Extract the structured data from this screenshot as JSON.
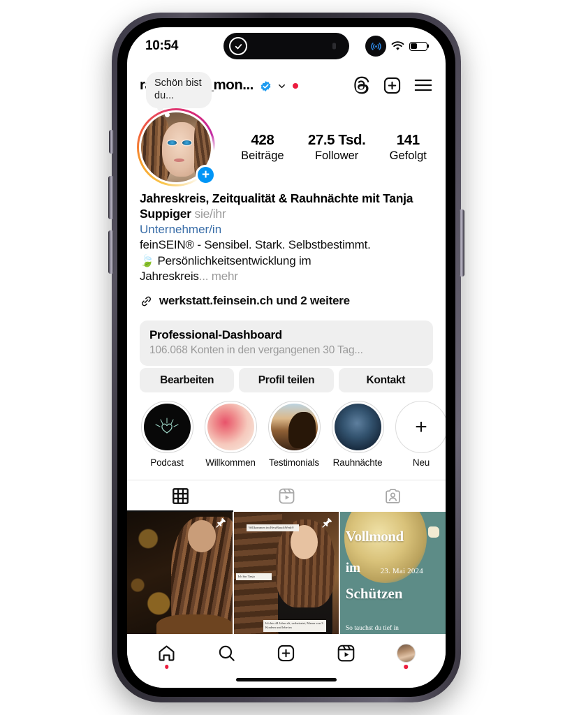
{
  "status_bar": {
    "time": "10:54",
    "dynamic_island_icon": "check-circle-icon",
    "airdrop_icon": "broadcast-icon",
    "wifi_icon": "wifi-icon",
    "battery_icon": "battery-icon",
    "battery_level_percent": 42
  },
  "header": {
    "username": "rauhnacht_mon...",
    "verified_icon": "verified-badge-icon",
    "chevron_icon": "chevron-down-icon",
    "notification_dot": "red-dot-indicator",
    "threads_icon": "threads-icon",
    "new_post_icon": "plus-box-icon",
    "menu_icon": "hamburger-menu-icon"
  },
  "profile": {
    "note_bubble": "Schön bist du...",
    "avatar_name": "profile-avatar",
    "add_story_icon": "plus-circle-icon",
    "stats": [
      {
        "value": "428",
        "label": "Beiträge"
      },
      {
        "value": "27.5 Tsd.",
        "label": "Follower"
      },
      {
        "value": "141",
        "label": "Gefolgt"
      }
    ],
    "display_name": "Jahreskreis, Zeitqualität & Rauhnächte mit Tanja Suppiger",
    "pronouns": "sie/ihr",
    "category": "Unternehmer/in",
    "bio_line_1": "feinSEIN® - Sensibel. Stark. Selbstbestimmt.",
    "bio_line_2": "🍃 Persönlichkeitsentwicklung im",
    "bio_line_3": "Jahreskreis",
    "bio_more": "... mehr",
    "link_icon": "link-chain-icon",
    "link_text": "werkstatt.feinsein.ch und 2 weitere"
  },
  "dashboard": {
    "title": "Professional-Dashboard",
    "subtitle": "106.068 Konten in den vergangenen 30 Tag..."
  },
  "actions": [
    {
      "label": "Bearbeiten"
    },
    {
      "label": "Profil teilen"
    },
    {
      "label": "Kontakt"
    }
  ],
  "highlights": [
    {
      "label": "Podcast",
      "cover": "cover-podcast"
    },
    {
      "label": "Willkommen",
      "cover": "cover-willkommen"
    },
    {
      "label": "Testimonials",
      "cover": "cover-testimonials"
    },
    {
      "label": "Rauhnächte",
      "cover": "cover-rauhnaechte"
    },
    {
      "label": "Neu",
      "cover": "add-new-highlight"
    }
  ],
  "tabs": [
    {
      "name": "grid-tab",
      "icon": "grid-icon",
      "active": true
    },
    {
      "name": "reels-tab",
      "icon": "reels-icon",
      "active": false
    },
    {
      "name": "tagged-tab",
      "icon": "tagged-person-icon",
      "active": false
    }
  ],
  "posts": [
    {
      "name": "post-writing",
      "pinned": true,
      "pin_icon": "pin-icon"
    },
    {
      "name": "post-willkommen",
      "pinned": true,
      "pin_icon": "pin-icon",
      "caption_1": "Willkommen im HerzBauchWerk®",
      "caption_2": "Ich bin Tanja",
      "caption_3": "Ich bin 44 Jahre alt, verheiratet, Mama von 3 Kindern und lebe im"
    },
    {
      "name": "post-vollmond",
      "pinned": false,
      "title_line_1": "Vollmond",
      "title_line_2": "im",
      "date": "23. Mai 2024",
      "title_line_3": "Schützen",
      "subtitle": "So tauchst du tief in"
    }
  ],
  "bottom_nav": [
    {
      "name": "nav-home",
      "icon": "home-icon",
      "badge": true
    },
    {
      "name": "nav-search",
      "icon": "search-icon",
      "badge": false
    },
    {
      "name": "nav-create",
      "icon": "plus-box-icon",
      "badge": false
    },
    {
      "name": "nav-reels",
      "icon": "reels-icon",
      "badge": false
    },
    {
      "name": "nav-profile",
      "icon": "profile-avatar-icon",
      "badge": true
    }
  ],
  "colors": {
    "instagram_blue": "#0095f6",
    "notification_red": "#ec1c3e",
    "link_blue": "#3a6ea8",
    "muted_gray": "#9a9a9a",
    "chip_gray": "#efefef"
  }
}
